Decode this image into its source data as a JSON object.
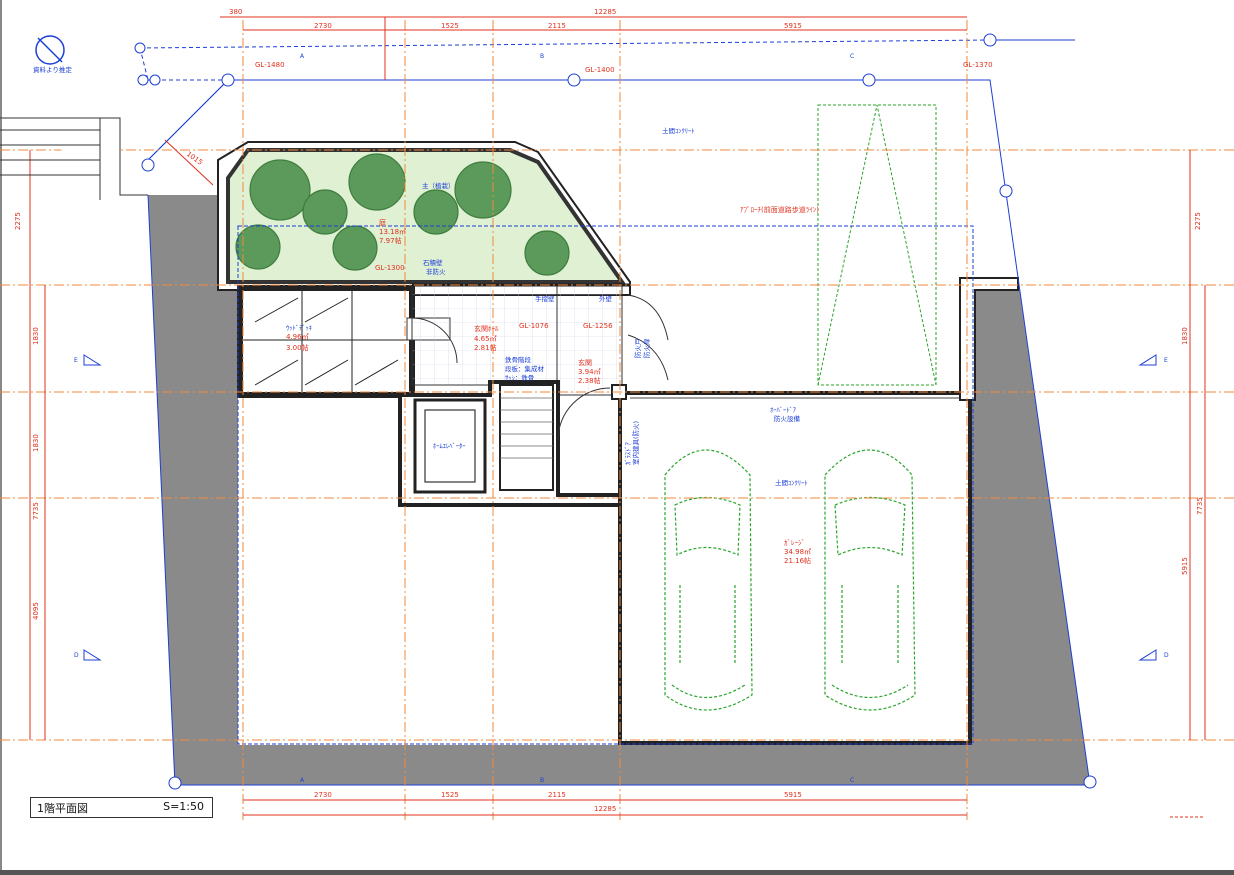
{
  "sheet": {
    "title": "1階平面図",
    "scale": "S=1:50",
    "north_label": "資料より推定"
  },
  "dimensions_top": {
    "overall": "12285",
    "offset": "380",
    "spans": [
      "2730",
      "1525",
      "2115",
      "5915"
    ]
  },
  "dimensions_bottom": {
    "overall": "12285",
    "spans": [
      "2730",
      "1525",
      "2115",
      "5915"
    ]
  },
  "dimensions_left": {
    "upper": "2275",
    "mid1": "1830",
    "mid2": "1830",
    "lower": "4095",
    "total": "7735"
  },
  "dimensions_right": {
    "upper": "2275",
    "mid": "1830",
    "lower": "5915",
    "total": "7735"
  },
  "levels": {
    "gl_1480": "GL-1480",
    "gl_1400": "GL-1400",
    "gl_1370": "GL-1370",
    "gl_1300": "GL-1300",
    "gl_1076": "GL-1076",
    "gl_1256": "GL-1256"
  },
  "section_marks": {
    "a": "A",
    "b": "B",
    "c": "C",
    "d": "D",
    "e": "E"
  },
  "rooms": {
    "garden_name": "庭",
    "garden_area": "13.18㎡",
    "garden_tsubo": "7.97帖",
    "tree_label": "主（植栽）",
    "wall_label": "石積壁",
    "wall_sub": "非防火",
    "yard_name": "ｳｯﾄﾞﾃﾞｯｷ",
    "yard_area": "4.96㎡",
    "yard_tsubo": "3.00帖",
    "hall_name": "玄関ﾎｰﾙ",
    "hall_area": "4.65㎡",
    "hall_tsubo": "2.81帖",
    "stair_note1": "鉄骨階段",
    "stair_note2": "段板：集成材",
    "stair_note3": "ｻｯｼ：鉄骨",
    "entry_name": "玄関",
    "entry_area": "3.94㎡",
    "entry_tsubo": "2.38帖",
    "elevator": "ﾎｰﾑｴﾚﾍﾞｰﾀｰ",
    "garage_name": "ｶﾞﾚｰｼﾞ",
    "garage_area": "34.98㎡",
    "garage_tsubo": "21.16帖",
    "garage_door": "ｵｰﾊﾞｰﾄﾞｱ",
    "garage_door_sub": "防火設備",
    "approach": "土間ｺﾝｸﾘｰﾄ",
    "approach2": "土間ｺﾝｸﾘｰﾄ",
    "parking": "ｱﾌﾟﾛｰﾁ(前面道路歩道ﾗｲﾝ)",
    "handrail": "手摺壁",
    "shutter": "防火戸",
    "shutter_sub": "防火扉",
    "side_door": "ｶﾞﾗｽﾄﾞｱ",
    "side_door_sub": "室内建具(防火)",
    "ex_wall": "外壁",
    "corner_dim": "1015"
  },
  "colors": {
    "dim": "#e0301e",
    "grid": "#f08a3c",
    "site": "#1c3fd6",
    "wall": "#8a8a8a",
    "plant": "#4c9a4c",
    "car": "#2aa52a"
  }
}
